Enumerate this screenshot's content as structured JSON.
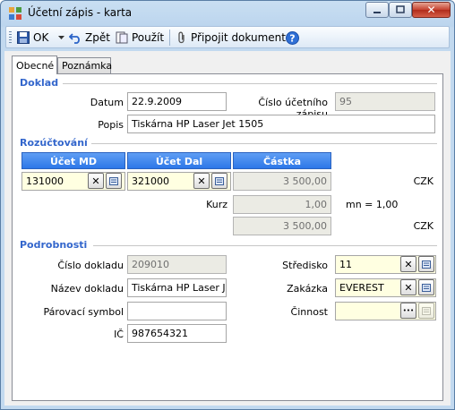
{
  "window": {
    "title": "Účetní zápis - karta",
    "close_glyph": "✕"
  },
  "toolbar": {
    "ok": "OK",
    "back": "Zpět",
    "apply": "Použít",
    "attach": "Připojit dokument"
  },
  "tabs": [
    "Obecné",
    "Poznámka"
  ],
  "doklad": {
    "section": "Doklad",
    "datum_label": "Datum",
    "datum_value": "22.9.2009",
    "cislo_label": "Číslo účetního zápisu",
    "cislo_value": "95",
    "popis_label": "Popis",
    "popis_value": "Tiskárna HP Laser Jet 1505"
  },
  "rozuctovani": {
    "section": "Rozúčtování",
    "headers": [
      "Účet MD",
      "Účet Dal",
      "Částka"
    ],
    "ucet_md": "131000",
    "ucet_dal": "321000",
    "castka": "3 500,00",
    "currency": "CZK",
    "kurz_label": "Kurz",
    "kurz_value": "1,00",
    "mn_text": "mn = 1,00",
    "castka2": "3 500,00",
    "currency2": "CZK"
  },
  "podrobnosti": {
    "section": "Podrobnosti",
    "cislo_dokladu_label": "Číslo dokladu",
    "cislo_dokladu_value": "209010",
    "nazev_label": "Název dokladu",
    "nazev_value": "Tiskárna HP Laser Jet",
    "parovaci_label": "Párovací symbol",
    "parovaci_value": "",
    "ic_label": "IČ",
    "ic_value": "987654321",
    "stredisko_label": "Středisko",
    "stredisko_value": "11",
    "zakazka_label": "Zakázka",
    "zakazka_value": "EVEREST",
    "cinnost_label": "Činnost",
    "cinnost_value": ""
  },
  "icons": {
    "clear": "✕",
    "pick": "list-icon",
    "dots": "•••"
  }
}
